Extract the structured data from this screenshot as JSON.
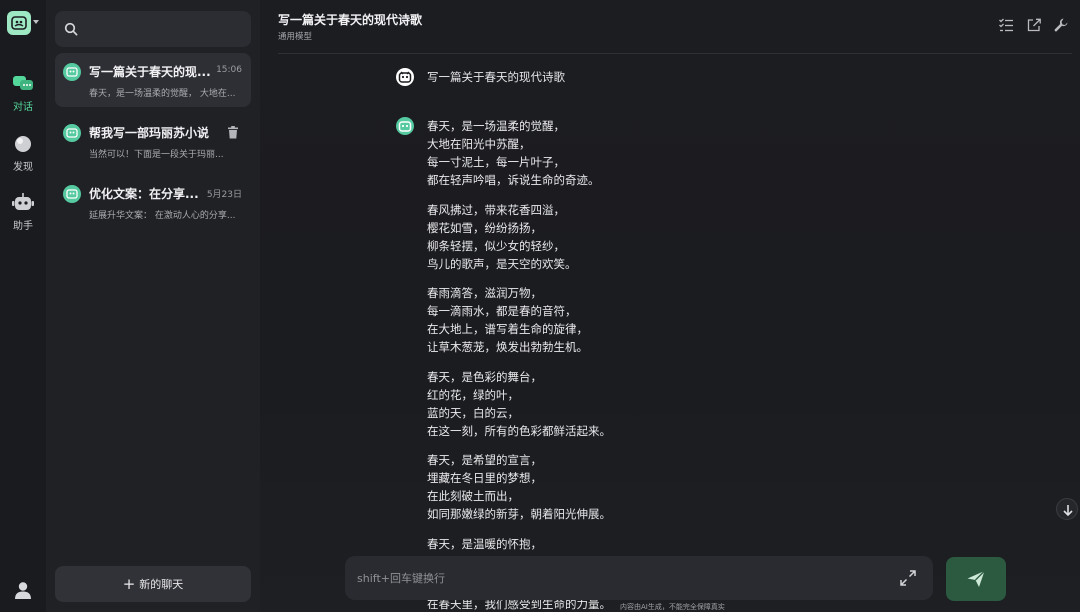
{
  "rail": {
    "items": [
      {
        "label": "对话",
        "icon": "chat-icon",
        "active": true
      },
      {
        "label": "发现",
        "icon": "discover-icon",
        "active": false
      },
      {
        "label": "助手",
        "icon": "robot-icon",
        "active": false
      }
    ],
    "user_icon": "user-icon"
  },
  "sidebar": {
    "search_placeholder": "",
    "conversations": [
      {
        "title": "写一篇关于春天的现...",
        "time": "15:06",
        "preview": "春天，是一场温柔的觉醒， 大地在..."
      },
      {
        "title": "帮我写一部玛丽苏小说",
        "time": "",
        "preview": "当然可以！下面是一段关于玛丽..."
      },
      {
        "title": "优化文案：在分享...",
        "time": "5月23日",
        "preview": "延展升华文案： 在激动人心的分享..."
      }
    ],
    "new_chat_label": "新的聊天"
  },
  "header": {
    "title": "写一篇关于春天的现代诗歌",
    "subtitle": "通用模型"
  },
  "user_message": "写一篇关于春天的现代诗歌",
  "assistant": {
    "stanzas": [
      [
        "春天，是一场温柔的觉醒，",
        "大地在阳光中苏醒，",
        "每一寸泥土，每一片叶子，",
        "都在轻声吟唱，诉说生命的奇迹。"
      ],
      [
        "春风拂过，带来花香四溢，",
        "樱花如雪，纷纷扬扬，",
        "柳条轻摆，似少女的轻纱，",
        "鸟儿的歌声，是天空的欢笑。"
      ],
      [
        "春雨滴答，滋润万物，",
        "每一滴雨水，都是春的音符，",
        "在大地上，谱写着生命的旋律，",
        "让草木葱茏，焕发出勃勃生机。"
      ],
      [
        "春天，是色彩的舞台，",
        "红的花，绿的叶，",
        "蓝的天，白的云，",
        "在这一刻，所有的色彩都鲜活起来。"
      ],
      [
        "春天，是希望的宣言，",
        "埋藏在冬日里的梦想，",
        "在此刻破土而出，",
        "如同那嫩绿的新芽，朝着阳光伸展。"
      ],
      [
        "春天，是温暖的怀抱，"
      ]
    ],
    "trailing_line": "在春天里，我们感受到生命的力量。"
  },
  "composer": {
    "placeholder": "shift+回车键换行",
    "disclaimer": "内容由AI生成，不能完全保障真实"
  },
  "colors": {
    "accent": "#54d79b",
    "send_bg": "#2b5a41",
    "avatar_bg": "#55c9a0"
  }
}
